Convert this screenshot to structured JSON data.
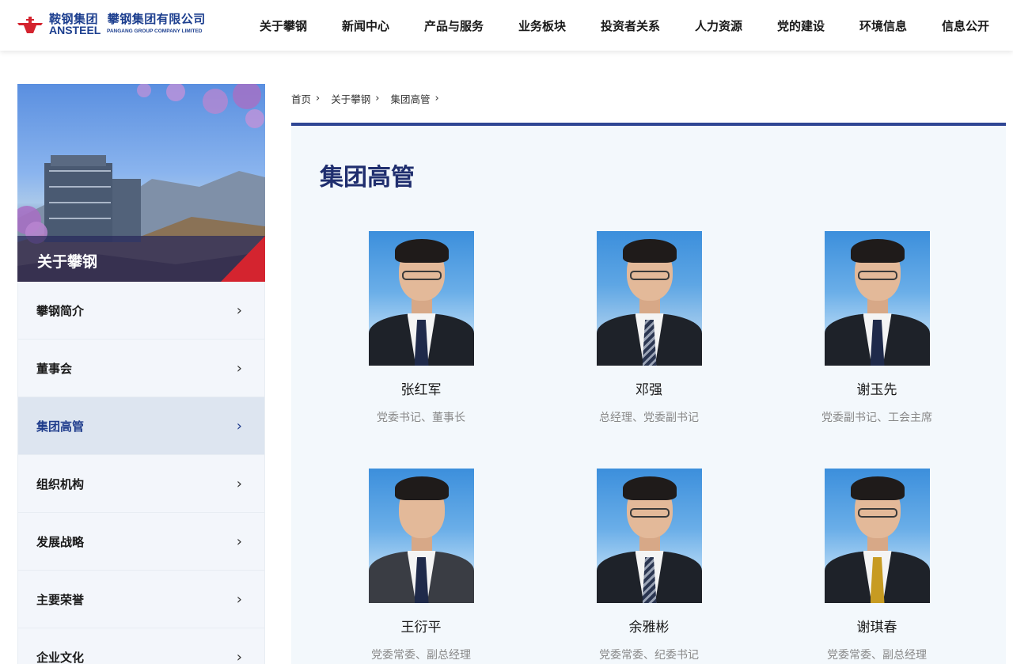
{
  "logo": {
    "cn1": "鞍钢集团",
    "cn2": "攀钢集团有限公司",
    "en1": "ANSTEEL",
    "en2": "PANGANG GROUP COMPANY LIMITED"
  },
  "nav": [
    {
      "label": "关于攀钢"
    },
    {
      "label": "新闻中心"
    },
    {
      "label": "产品与服务"
    },
    {
      "label": "业务板块"
    },
    {
      "label": "投资者关系"
    },
    {
      "label": "人力资源"
    },
    {
      "label": "党的建设"
    },
    {
      "label": "环境信息"
    },
    {
      "label": "信息公开"
    }
  ],
  "sidebar": {
    "banner_title": "关于攀钢",
    "items": [
      {
        "label": "攀钢简介",
        "active": false
      },
      {
        "label": "董事会",
        "active": false
      },
      {
        "label": "集团高管",
        "active": true
      },
      {
        "label": "组织机构",
        "active": false
      },
      {
        "label": "发展战略",
        "active": false
      },
      {
        "label": "主要荣誉",
        "active": false
      },
      {
        "label": "企业文化",
        "active": false
      }
    ],
    "chevron": "›"
  },
  "breadcrumb": [
    "首页",
    "关于攀钢",
    "集团高管"
  ],
  "breadcrumb_sep": "›",
  "content": {
    "title": "集团高管",
    "people": [
      {
        "name": "张红军",
        "title": "党委书记、董事长",
        "tie": "dark"
      },
      {
        "name": "邓强",
        "title": "总经理、党委副书记",
        "tie": "stripe"
      },
      {
        "name": "谢玉先",
        "title": "党委副书记、工会主席",
        "tie": "dark"
      },
      {
        "name": "王衍平",
        "title": "党委常委、副总经理",
        "tie": "dark"
      },
      {
        "name": "余雅彬",
        "title": "党委常委、纪委书记",
        "tie": "stripe"
      },
      {
        "name": "谢琪春",
        "title": "党委常委、副总经理",
        "tie": "gold"
      }
    ]
  },
  "colors": {
    "brand": "#1f2e6e",
    "accent_red": "#d4242f",
    "content_border": "#2f4694",
    "active_bg": "#dde5f0"
  }
}
